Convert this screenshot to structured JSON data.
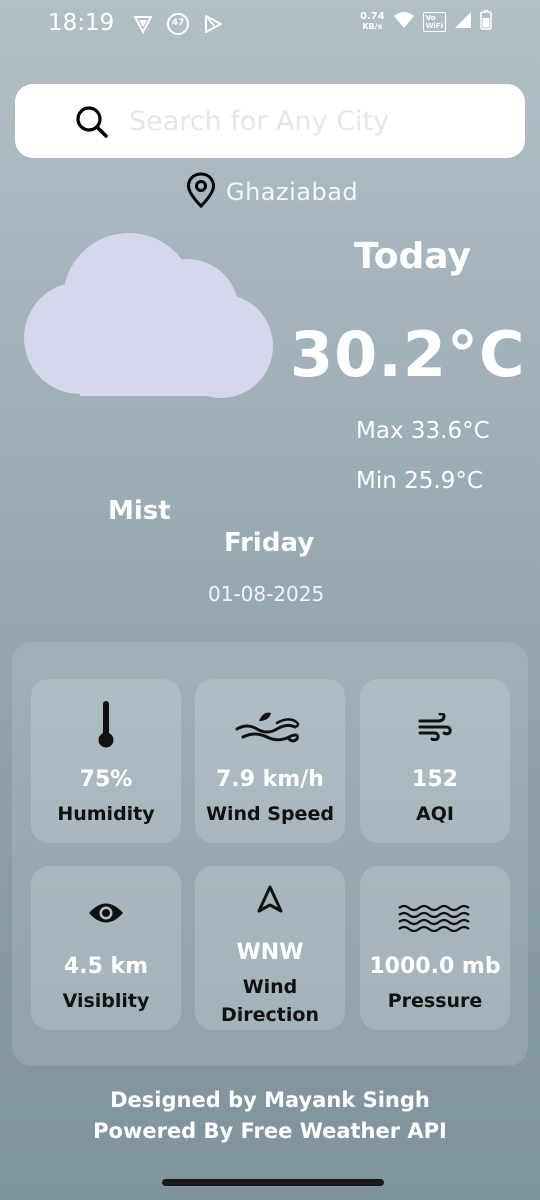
{
  "status_bar": {
    "time": "18:19",
    "badge_count": "47",
    "net_speed_value": "0.74",
    "net_speed_unit": "KB/s",
    "vowifi_top": "Vo",
    "vowifi_bottom": "WiFi"
  },
  "search": {
    "placeholder": "Search for Any City"
  },
  "location": {
    "city": "Ghaziabad"
  },
  "weather": {
    "today_label": "Today",
    "temperature": "30.2°C",
    "max": "Max 33.6°C",
    "min": "Min 25.9°C",
    "condition": "Mist",
    "day": "Friday",
    "date": "01-08-2025",
    "icon": "cloud-icon"
  },
  "cards": [
    {
      "icon": "thermometer-icon",
      "value": "75%",
      "label": "Humidity"
    },
    {
      "icon": "wind-waves-icon",
      "value": "7.9 km/h",
      "label": "Wind Speed"
    },
    {
      "icon": "wind-icon",
      "value": "152",
      "label": "AQI"
    },
    {
      "icon": "eye-icon",
      "value": "4.5 km",
      "label": "Visiblity"
    },
    {
      "icon": "navigation-arrow-icon",
      "value": "WNW",
      "label_line1": "Wind",
      "label_line2": "Direction"
    },
    {
      "icon": "water-waves-icon",
      "value": "1000.0 mb",
      "label": "Pressure"
    }
  ],
  "footer": {
    "line1": "Designed by Mayank Singh",
    "line2": "Powered By Free Weather API"
  },
  "colors": {
    "cloud": "#d6d7ec",
    "background_top": "#b2bfc5",
    "background_bottom": "#7f939d"
  }
}
